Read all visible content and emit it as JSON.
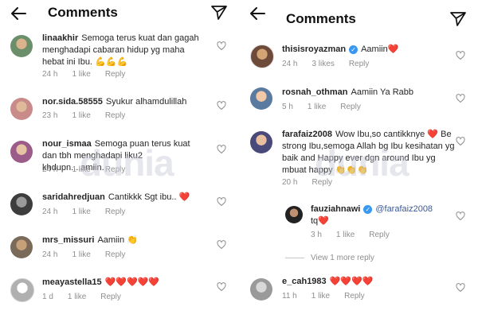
{
  "left": {
    "title": "Comments",
    "comments": [
      {
        "username": "linaakhir",
        "text": "Semoga terus kuat dan gagah menghadapi cabaran hidup yg maha hebat ini Ibu. 💪💪💪",
        "time": "24 h",
        "likes": "1 like",
        "reply": "Reply"
      },
      {
        "username": "nor.sida.58555",
        "text": "Syukur alhamdulillah",
        "time": "23 h",
        "likes": "1 like",
        "reply": "Reply"
      },
      {
        "username": "nour_ismaa",
        "text": "Semoga puan terus kuat dan tbh menghadapi liku2 khdupn....amiin.",
        "time": "24 h",
        "likes": "1 like",
        "reply": "Reply"
      },
      {
        "username": "saridahredjuan",
        "text": "Cantikkk Sgt ibu.. ❤️",
        "time": "24 h",
        "likes": "1 like",
        "reply": "Reply"
      },
      {
        "username": "mrs_missuri",
        "text": "Aamiin 👏",
        "time": "24 h",
        "likes": "1 like",
        "reply": "Reply"
      },
      {
        "username": "meayastella15",
        "text": "❤️❤️❤️❤️❤️",
        "time": "1 d",
        "likes": "1 like",
        "reply": "Reply"
      }
    ]
  },
  "right": {
    "title": "Comments",
    "comments": [
      {
        "username": "thisisroyazman",
        "text": "Aamiin❤️",
        "time": "24 h",
        "likes": "3 likes",
        "reply": "Reply"
      },
      {
        "username": "rosnah_othman",
        "text": "Aamiin Ya Rabb",
        "time": "5 h",
        "likes": "1 like",
        "reply": "Reply"
      },
      {
        "username": "farafaiz2008",
        "text": "Wow Ibu,so cantikknye ❤️ Be strong Ibu,semoga Allah bg Ibu kesihatan yg baik and Happy ever dgn around Ibu yg mbuat happy 👏👏👏",
        "time": "20 h",
        "reply": "Reply"
      },
      {
        "username": "fauziahnawi",
        "mention": "@farafaiz2008",
        "text": "tq❤️",
        "time": "3 h",
        "likes": "1 like",
        "reply": "Reply"
      },
      {
        "username": "e_cah1983",
        "text": "❤️❤️❤️❤️",
        "time": "11 h",
        "likes": "1 like",
        "reply": "Reply"
      }
    ],
    "view_more": "View 1 more reply"
  },
  "watermark": "dunia",
  "colors": {
    "text": "#262626",
    "meta": "#8e8e8e",
    "verified": "#3897f0",
    "heart": "#ed1c24"
  },
  "icons": [
    "back-arrow-icon",
    "send-icon",
    "heart-icon",
    "verified-icon"
  ]
}
